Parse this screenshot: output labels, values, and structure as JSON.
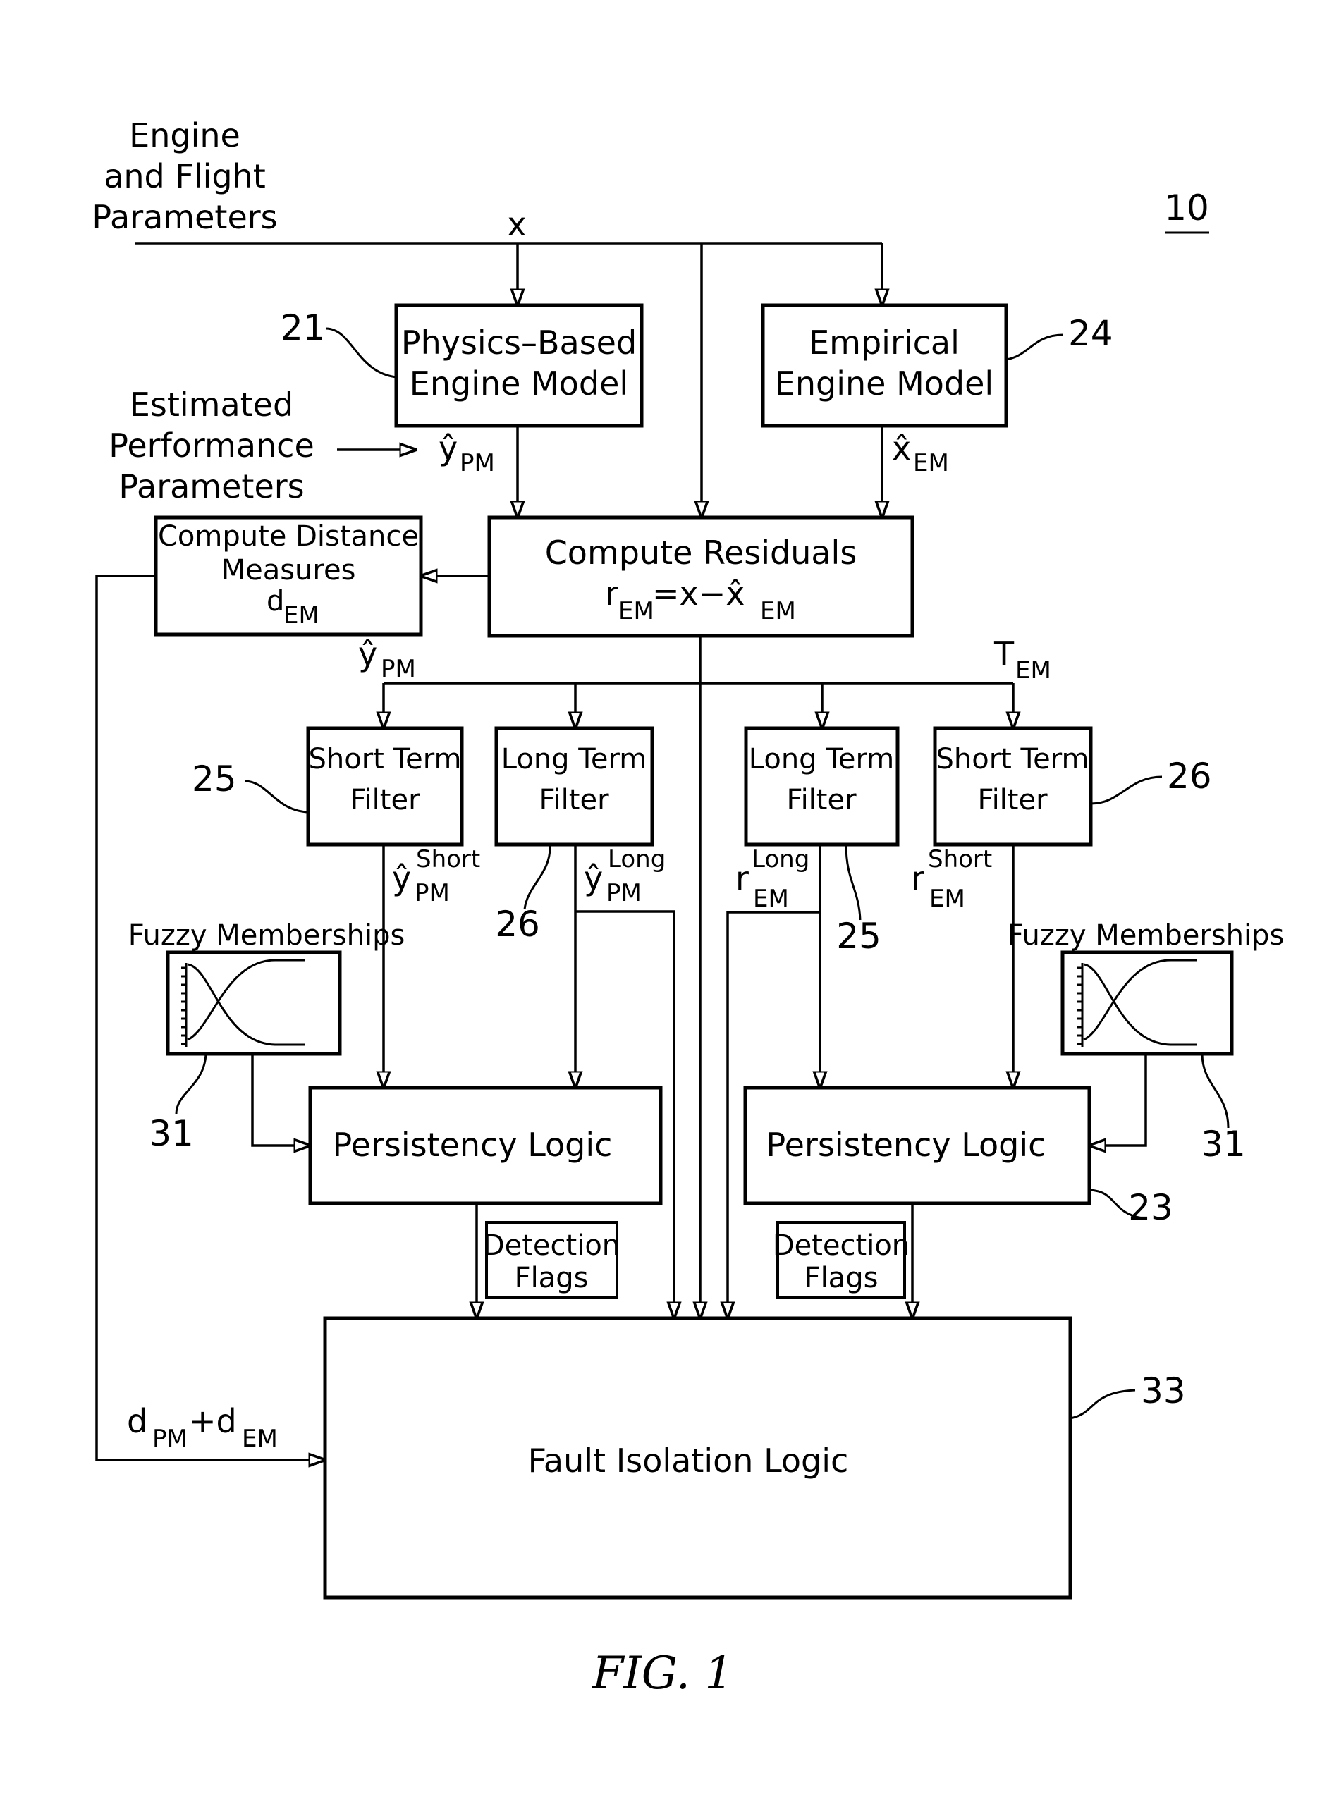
{
  "figure": {
    "reference_number": "10",
    "caption": "FIG. 1"
  },
  "inputs": {
    "title_lines": [
      "Engine",
      "and Flight",
      "Parameters"
    ],
    "signal": "x"
  },
  "estimated_label": {
    "lines": [
      "Estimated",
      "Performance",
      "Parameters"
    ]
  },
  "blocks": {
    "physics_model": {
      "lines": [
        "Physics–Based",
        "Engine  Model"
      ],
      "ref": "21"
    },
    "empirical_model": {
      "lines": [
        "Empirical",
        "Engine  Model"
      ],
      "ref": "24"
    },
    "distance": {
      "lines": [
        "Compute Distance",
        "Measures"
      ],
      "symbol": "d",
      "subscript": "EM"
    },
    "residuals": {
      "title": "Compute  Residuals",
      "formula_r": "r",
      "formula_sub1": "EM",
      "formula_mid": "=x−x̂",
      "formula_sub2": "EM"
    },
    "filter_st_pm": {
      "lines": [
        "Short  Term",
        "Filter"
      ],
      "ref": "25"
    },
    "filter_lt_pm": {
      "lines": [
        "Long  Term",
        "Filter"
      ],
      "ref": "26"
    },
    "filter_lt_em": {
      "lines": [
        "Long  Term",
        "Filter"
      ],
      "ref": "25"
    },
    "filter_st_em": {
      "lines": [
        "Short  Term",
        "Filter"
      ],
      "ref": "26"
    },
    "fuzzy_left": {
      "title": "Fuzzy  Memberships",
      "ref": "31"
    },
    "fuzzy_right": {
      "title": "Fuzzy  Memberships",
      "ref": "31"
    },
    "persistency_left": {
      "label": "Persistency  Logic"
    },
    "persistency_right": {
      "label": "Persistency  Logic",
      "ref": "23"
    },
    "flags_left": {
      "lines": [
        "Detection",
        "Flags"
      ]
    },
    "flags_right": {
      "lines": [
        "Detection",
        "Flags"
      ]
    },
    "fault_isolation": {
      "label": "Fault  Isolation  Logic",
      "ref": "33"
    }
  },
  "signals": {
    "y_pm_hat": {
      "base": "ŷ",
      "sub": "PM"
    },
    "x_em_hat": {
      "base": "x̂",
      "sub": "EM"
    },
    "y_pm_bus": {
      "base": "ŷ",
      "sub": "PM"
    },
    "t_em": {
      "base": "T",
      "sub": "EM"
    },
    "y_pm_short": {
      "base": "ŷ",
      "sup": "Short",
      "sub": "PM"
    },
    "y_pm_long": {
      "base": "ŷ",
      "sup": "Long",
      "sub": "PM"
    },
    "r_em_long": {
      "base": "r",
      "sup": "Long",
      "sub": "EM"
    },
    "r_em_short": {
      "base": "r",
      "sup": "Short",
      "sub": "EM"
    },
    "distance_sum": {
      "d1": "d",
      "sub1": "PM",
      "plus": "+d",
      "sub2": "EM"
    }
  }
}
